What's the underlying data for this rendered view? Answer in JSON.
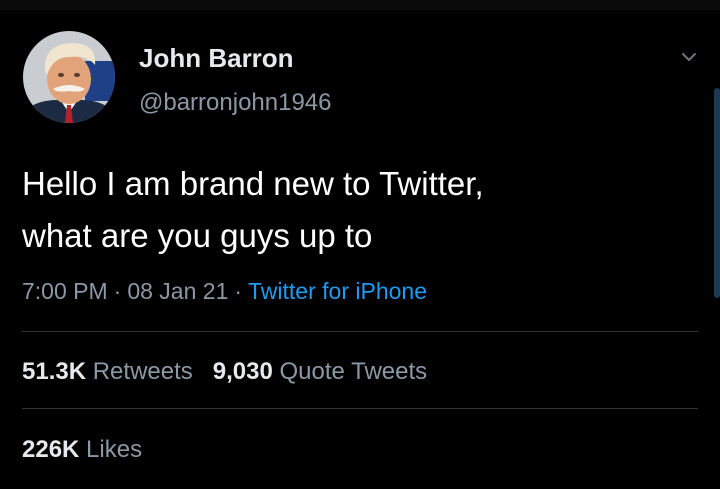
{
  "tweet": {
    "author": {
      "display_name": "John Barron",
      "handle": "@barronjohn1946",
      "avatar_icon": "profile-photo"
    },
    "menu_icon": "chevron-down-icon",
    "text_lines": [
      "Hello I am brand new to Twitter,",
      "what are you guys up to"
    ],
    "time": "7:00 PM",
    "date": "08 Jan 21",
    "separator": "·",
    "source": "Twitter for iPhone",
    "stats": {
      "retweets_count": "51.3K",
      "retweets_label": "Retweets",
      "quotes_count": "9,030",
      "quotes_label": "Quote Tweets",
      "likes_count": "226K",
      "likes_label": "Likes"
    }
  },
  "colors": {
    "background": "#000000",
    "primary_text": "#e7e9ea",
    "secondary_text": "#8b98a5",
    "link": "#1d9bf0",
    "divider": "#2f3336"
  }
}
